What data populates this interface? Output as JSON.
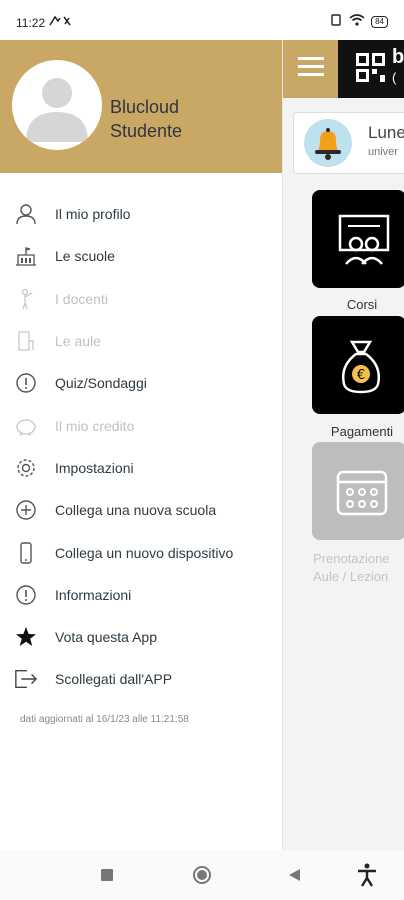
{
  "status": {
    "time": "11:22",
    "battery": "84"
  },
  "user": {
    "first": "Blucloud",
    "second": "Studente"
  },
  "menu": [
    {
      "label": "Il mio profilo",
      "icon": "user-icon",
      "enabled": true
    },
    {
      "label": "Le scuole",
      "icon": "school-icon",
      "enabled": true
    },
    {
      "label": "I docenti",
      "icon": "teacher-icon",
      "enabled": false
    },
    {
      "label": "Le aule",
      "icon": "classroom-icon",
      "enabled": false
    },
    {
      "label": "Quiz/Sondaggi",
      "icon": "info-circle-icon",
      "enabled": true
    },
    {
      "label": "Il mio credito",
      "icon": "piggy-bank-icon",
      "enabled": false
    },
    {
      "label": "Impostazioni",
      "icon": "gear-icon",
      "enabled": true
    },
    {
      "label": "Collega una nuova scuola",
      "icon": "plus-circle-icon",
      "enabled": true
    },
    {
      "label": "Collega un nuovo dispositivo",
      "icon": "phone-icon",
      "enabled": true
    },
    {
      "label": "Informazioni",
      "icon": "info-circle-icon",
      "enabled": true
    },
    {
      "label": "Vota questa App",
      "icon": "star-icon",
      "enabled": true
    },
    {
      "label": "Scollegati dall'APP",
      "icon": "logout-icon",
      "enabled": true
    }
  ],
  "updated_text": "dati aggiornati al 16/1/23 alle 11:21:58",
  "background": {
    "header_letter": "b",
    "header_sub": "(",
    "announcement_title": "Lune",
    "announcement_sub": "univer",
    "tiles": [
      {
        "label": "Corsi"
      },
      {
        "label": "Pagamenti"
      },
      {
        "label_line1": "Prenotazione",
        "label_line2": "Aule / Lezion"
      }
    ]
  },
  "colors": {
    "header_gold": "#c9a865",
    "text_dark": "#2d3b44",
    "disabled": "#c0c0c0"
  }
}
